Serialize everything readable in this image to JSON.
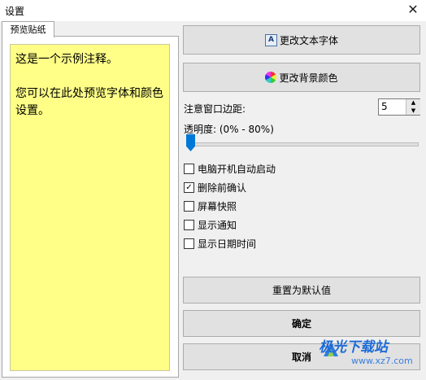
{
  "window": {
    "title": "设置",
    "close_glyph": "✕"
  },
  "tab": {
    "label": "预览贴纸"
  },
  "note": {
    "text": "这是一个示例注释。\n\n您可以在此处预览字体和颜色设置。"
  },
  "buttons": {
    "change_font": "更改文本字体",
    "change_bg": "更改背景颜色",
    "reset": "重置为默认值",
    "ok": "确定",
    "cancel": "取消"
  },
  "margin": {
    "label": "注意窗口边距:",
    "value": "5"
  },
  "opacity": {
    "label": "透明度: (0% - 80%)",
    "value_percent": 0
  },
  "checkboxes": [
    {
      "label": "电脑开机自动启动",
      "checked": false
    },
    {
      "label": "删除前确认",
      "checked": true
    },
    {
      "label": "屏幕快照",
      "checked": false
    },
    {
      "label": "显示通知",
      "checked": false
    },
    {
      "label": "显示日期时间",
      "checked": false
    }
  ],
  "watermark": {
    "name": "极光下载站",
    "url": "www.xz7.com"
  },
  "icons": {
    "font_button": "font-icon",
    "color_button": "color-wheel-icon"
  }
}
